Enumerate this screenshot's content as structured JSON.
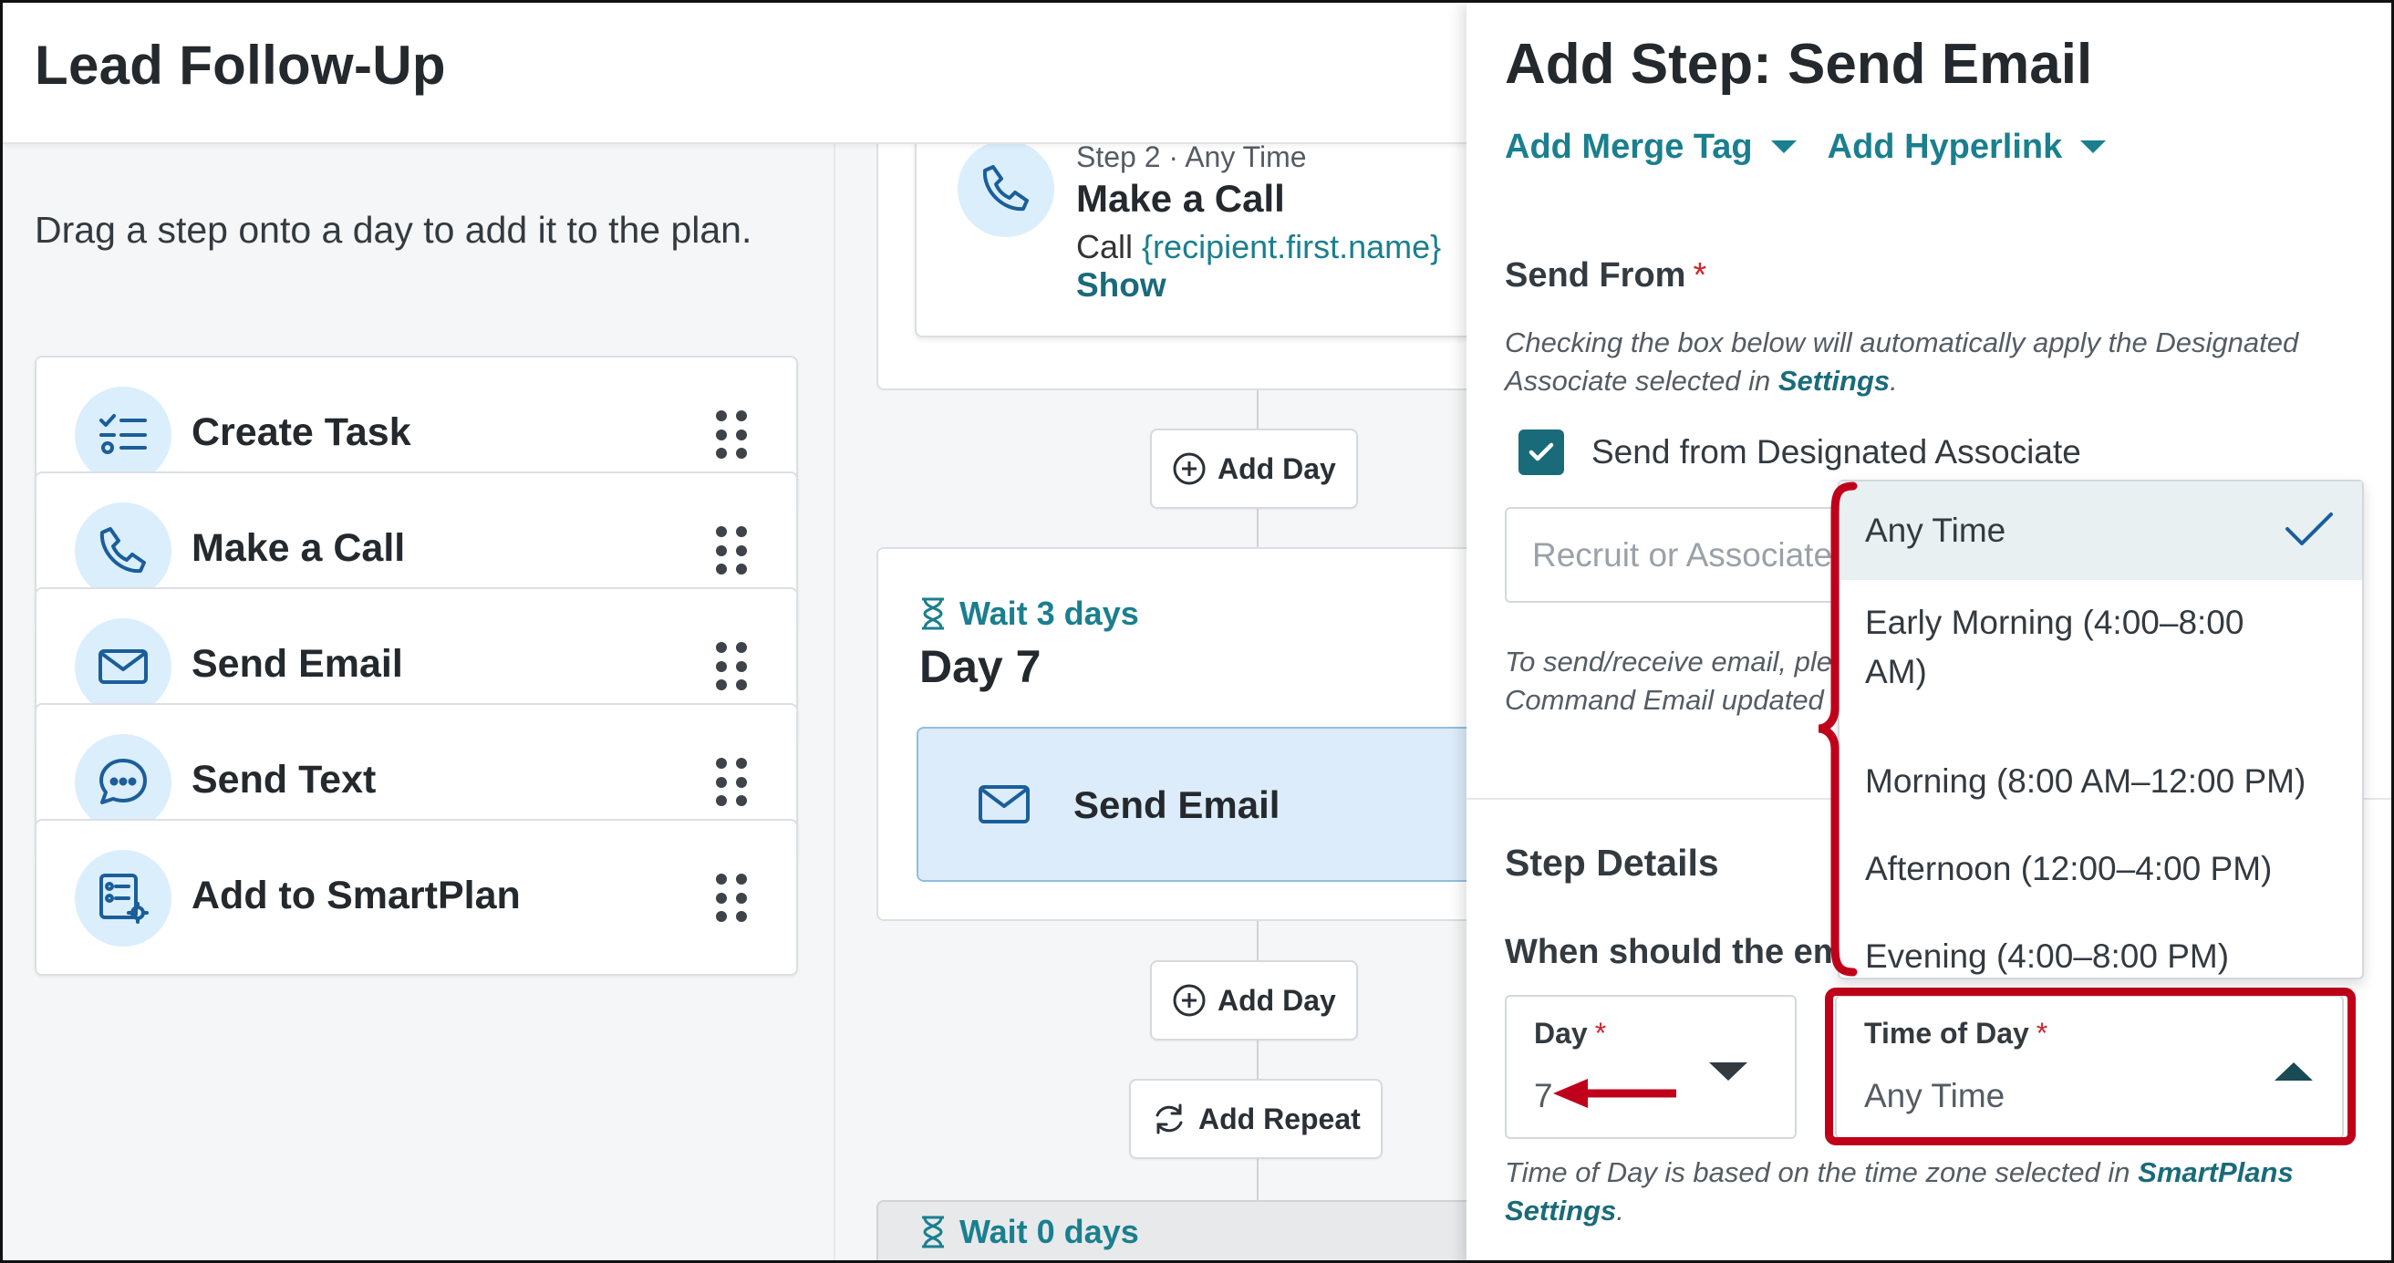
{
  "header": {
    "title": "Lead Follow-Up"
  },
  "palette": {
    "hint": "Drag a step onto a day to add it to the plan.",
    "items": [
      {
        "label": "Create Task",
        "icon": "task-list-icon"
      },
      {
        "label": "Make a Call",
        "icon": "phone-icon"
      },
      {
        "label": "Send Email",
        "icon": "envelope-icon"
      },
      {
        "label": "Send Text",
        "icon": "chat-bubble-icon"
      },
      {
        "label": "Add to SmartPlan",
        "icon": "smartplan-icon"
      }
    ]
  },
  "plan": {
    "call_step": {
      "meta": "Step 2 · Any Time",
      "title": "Make a Call",
      "body_prefix": "Call ",
      "body_tag": "{recipient.first.name}",
      "show_label": "Show"
    },
    "add_day_label": "Add Day",
    "add_repeat_label": "Add Repeat",
    "day7": {
      "wait": "Wait 3 days",
      "title": "Day 7",
      "step_label": "Send Email"
    },
    "next_block": {
      "wait": "Wait 0 days"
    }
  },
  "panel": {
    "title": "Add Step: Send Email",
    "merge_tag": "Add Merge Tag",
    "hyperlink": "Add Hyperlink",
    "send_from": {
      "label": "Send From",
      "required_mark": "*",
      "note_text": "Checking the box below will automatically apply the Designated Associate selected in ",
      "note_link": "Settings",
      "note_end": ".",
      "checkbox_label": "Send from Designated Associate",
      "checked": true,
      "assoc_placeholder": "Recruit or Associate",
      "email_note_line1": "To send/receive email, ple",
      "email_note_line2": "Command Email updated"
    },
    "step_details": {
      "heading": "Step Details",
      "question": "When should the em",
      "day": {
        "label": "Day",
        "required_mark": "*",
        "value": "7"
      },
      "time_of_day": {
        "label": "Time of Day",
        "required_mark": "*",
        "value": "Any Time"
      },
      "tz_note": "Time of Day is based on the time zone selected in ",
      "tz_link_1": "SmartPlans",
      "tz_link_2": "Settings",
      "tz_end": "."
    },
    "time_options": [
      {
        "label": "Any Time",
        "selected": true
      },
      {
        "label": "Early Morning (4:00–8:00 AM)",
        "selected": false
      },
      {
        "label": "Morning (8:00 AM–12:00 PM)",
        "selected": false
      },
      {
        "label": "Afternoon (12:00–4:00 PM)",
        "selected": false
      },
      {
        "label": "Evening (4:00–8:00 PM)",
        "selected": false
      }
    ]
  },
  "colors": {
    "accent_teal": "#1a7f8e",
    "annotation_red": "#c0001a",
    "icon_bg": "#dbeefc",
    "icon_stroke": "#1b5e9a"
  }
}
